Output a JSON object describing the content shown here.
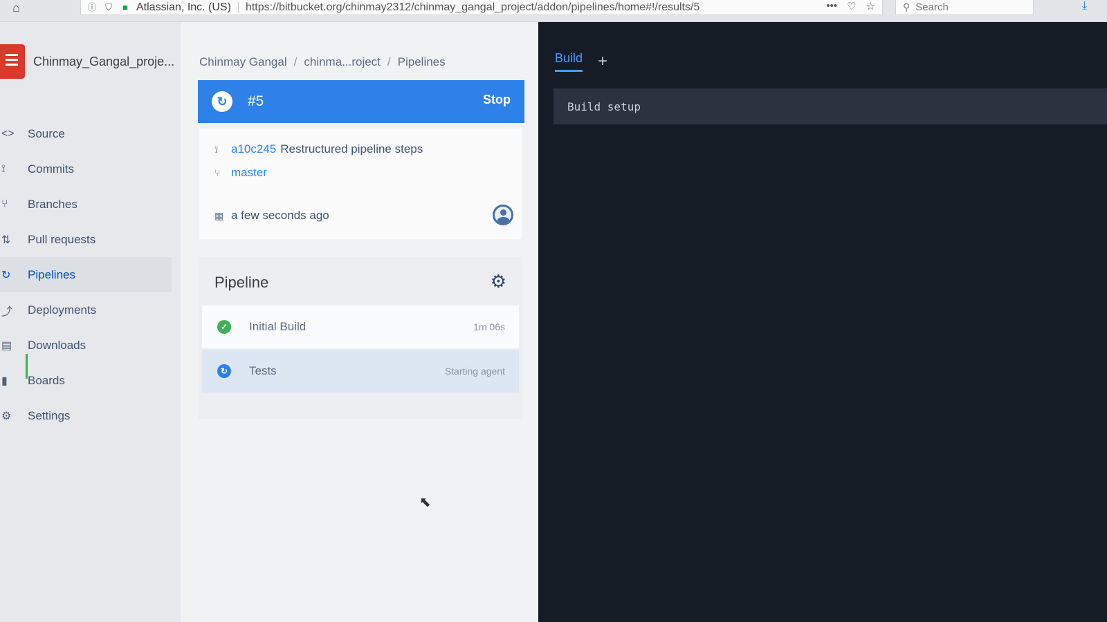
{
  "browser": {
    "identity": "Atlassian, Inc. (US)",
    "url": "https://bitbucket.org/chinmay2312/chinmay_gangal_project/addon/pipelines/home#!/results/5",
    "search_placeholder": "Search",
    "menu_dots": "•••"
  },
  "project": {
    "name": "Chinmay_Gangal_proje..."
  },
  "nav": [
    {
      "label": "Source",
      "icon": "code-icon"
    },
    {
      "label": "Commits",
      "icon": "commit-icon"
    },
    {
      "label": "Branches",
      "icon": "branch-icon"
    },
    {
      "label": "Pull requests",
      "icon": "pull-request-icon"
    },
    {
      "label": "Pipelines",
      "icon": "pipelines-icon"
    },
    {
      "label": "Deployments",
      "icon": "deployments-icon"
    },
    {
      "label": "Downloads",
      "icon": "downloads-icon"
    },
    {
      "label": "Boards",
      "icon": "boards-icon"
    },
    {
      "label": "Settings",
      "icon": "settings-icon"
    }
  ],
  "breadcrumb": [
    "Chinmay Gangal",
    "chinma...roject",
    "Pipelines"
  ],
  "run": {
    "number": "#5",
    "stop_label": "Stop",
    "color": "#2d81e8"
  },
  "commit": {
    "hash": "a10c245",
    "message": "Restructured pipeline steps",
    "branch": "master",
    "time": "a few seconds ago"
  },
  "pipeline": {
    "title": "Pipeline",
    "steps": [
      {
        "name": "Initial Build",
        "status": "1m 06s"
      },
      {
        "name": "Tests",
        "status": "Starting agent"
      }
    ]
  },
  "log": {
    "tab": "Build",
    "add": "+",
    "section": "Build setup"
  }
}
